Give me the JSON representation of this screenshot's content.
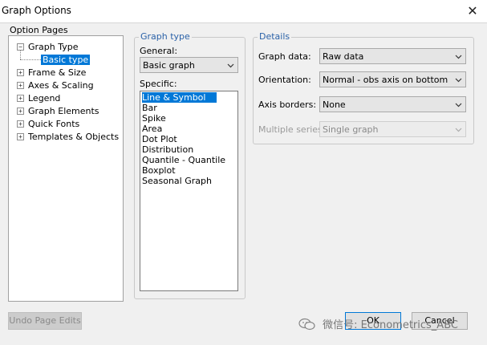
{
  "window": {
    "title": "Graph Options"
  },
  "close_icon": "close-icon",
  "option_pages": {
    "label": "Option Pages",
    "items": [
      {
        "label": "Graph Type",
        "expander": "−"
      },
      {
        "label": "Basic type"
      },
      {
        "label": "Frame & Size",
        "expander": "+"
      },
      {
        "label": "Axes & Scaling",
        "expander": "+"
      },
      {
        "label": "Legend",
        "expander": "+"
      },
      {
        "label": "Graph Elements",
        "expander": "+"
      },
      {
        "label": "Quick Fonts",
        "expander": "+"
      },
      {
        "label": "Templates & Objects",
        "expander": "+"
      }
    ]
  },
  "graph_type": {
    "title": "Graph type",
    "general_label": "General:",
    "general_value": "Basic graph",
    "specific_label": "Specific:",
    "specific_items": [
      "Line & Symbol",
      "Bar",
      "Spike",
      "Area",
      "Dot Plot",
      "Distribution",
      "Quantile - Quantile",
      "Boxplot",
      "Seasonal Graph"
    ],
    "specific_selected": "Line & Symbol"
  },
  "details": {
    "title": "Details",
    "graph_data_label": "Graph data:",
    "graph_data_value": "Raw data",
    "orientation_label": "Orientation:",
    "orientation_value": "Normal - obs axis on bottom",
    "axis_borders_label": "Axis borders:",
    "axis_borders_value": "None",
    "multiple_series_label": "Multiple series:",
    "multiple_series_value": "Single graph"
  },
  "buttons": {
    "undo": "Undo Page Edits",
    "ok": "OK",
    "cancel": "Cancel"
  },
  "watermark": {
    "text": "微信号: Econometrics_ABC"
  },
  "colors": {
    "selection": "#0078d7",
    "group_title": "#2b62a8"
  }
}
